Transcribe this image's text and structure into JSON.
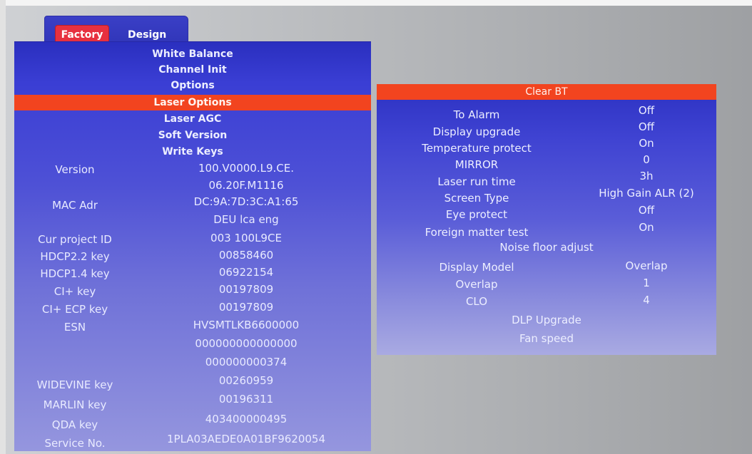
{
  "tabs": {
    "factory": "Factory",
    "design": "Design"
  },
  "menu": [
    "White Balance",
    "Channel Init",
    "Options",
    "Laser Options",
    "Laser AGC",
    "Soft Version",
    "Write Keys"
  ],
  "selected_menu_index": 3,
  "info": {
    "version_label": "Version",
    "version_line1": "100.V0000.L9.CE.",
    "version_line2": "06.20F.M1116",
    "mac_label": "MAC Adr",
    "mac_value": "DC:9A:7D:3C:A1:65",
    "lang_value": "DEU lca eng",
    "cur_project_label": "Cur project ID",
    "cur_project_value": "003 100L9CE",
    "hdcp22_label": "HDCP2.2 key",
    "hdcp22_value": "00858460",
    "hdcp14_label": "HDCP1.4 key",
    "hdcp14_value": "06922154",
    "ciplus_label": "CI+ key",
    "ciplus_value": "00197809",
    "ciplus_ecp_label": "CI+ ECP key",
    "ciplus_ecp_value": "00197809",
    "esn_label": "ESN",
    "esn_line1": "HVSMTLKB6600000",
    "esn_line2": "000000000000000",
    "esn_line3": "000000000374",
    "widevine_label": "WIDEVINE key",
    "widevine_value": "00260959",
    "marlin_label": "MARLIN key",
    "marlin_value": "00196311",
    "qda_label": "QDA key",
    "qda_value": "403400000495",
    "service_label": "Service No.",
    "service_value": "1PLA03AEDE0A01BF9620054"
  },
  "laser_options": {
    "clear_bt": "Clear BT",
    "to_alarm_label": "To Alarm",
    "to_alarm_value": "Off",
    "display_upgrade_label": "Display upgrade",
    "display_upgrade_value": "Off",
    "temperature_protect_label": "Temperature protect",
    "temperature_protect_value": "On",
    "mirror_label": "MIRROR",
    "mirror_value": "0",
    "laser_run_time_label": "Laser run time",
    "laser_run_time_value": "3h",
    "screen_type_label": "Screen Type",
    "screen_type_value": "High Gain ALR (2)",
    "eye_protect_label": "Eye protect",
    "eye_protect_value": "Off",
    "foreign_matter_label": "Foreign matter test",
    "foreign_matter_value": "On",
    "noise_floor_label": "Noise floor adjust",
    "display_model_label": "Display Model",
    "display_model_value": "Overlap",
    "overlap_label": "Overlap",
    "overlap_value": "1",
    "clo_label": "CLO",
    "clo_value": "4",
    "dlp_upgrade_label": "DLP Upgrade",
    "fan_speed_label": "Fan speed"
  }
}
